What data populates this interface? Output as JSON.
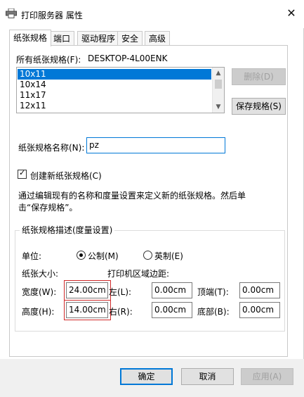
{
  "window": {
    "title": "打印服务器 属性",
    "close_glyph": "✕"
  },
  "tabs": [
    {
      "label": "纸张规格"
    },
    {
      "label": "端口"
    },
    {
      "label": "驱动程序"
    },
    {
      "label": "安全"
    },
    {
      "label": "高级"
    }
  ],
  "forms": {
    "all_forms_label": "所有纸张规格(F):",
    "server_name": "DESKTOP-4L00ENK",
    "list_items": [
      "10x11",
      "10x14",
      "11x17",
      "12x11"
    ],
    "delete_button": "删除(D)",
    "save_button": "保存规格(S)",
    "form_name_label": "纸张规格名称(N):",
    "form_name_value": "pz",
    "create_new_label": "创建新纸张规格(C)",
    "description_line1": "通过编辑现有的名称和度量设置来定义新的纸张规格。然后单",
    "description_line2": "击“保存规格”。"
  },
  "measurements": {
    "group_title": "纸张规格描述(度量设置)",
    "units_label": "单位:",
    "metric_label": "公制(M)",
    "english_label": "英制(E)",
    "paper_size_label": "纸张大小:",
    "margins_label": "打印机区域边距:",
    "width_label": "宽度(W):",
    "width_value": "24.00cm",
    "height_label": "高度(H):",
    "height_value": "14.00cm",
    "left_label": "左(L):",
    "left_value": "0.00cm",
    "right_label": "右(R):",
    "right_value": "0.00cm",
    "top_label": "顶端(T):",
    "top_value": "0.00cm",
    "bottom_label": "底部(B):",
    "bottom_value": "0.00cm"
  },
  "footer": {
    "ok": "确定",
    "cancel": "取消",
    "apply": "应用(A)"
  },
  "colors": {
    "accent": "#0078d7",
    "highlight_box": "#d02a2a"
  }
}
